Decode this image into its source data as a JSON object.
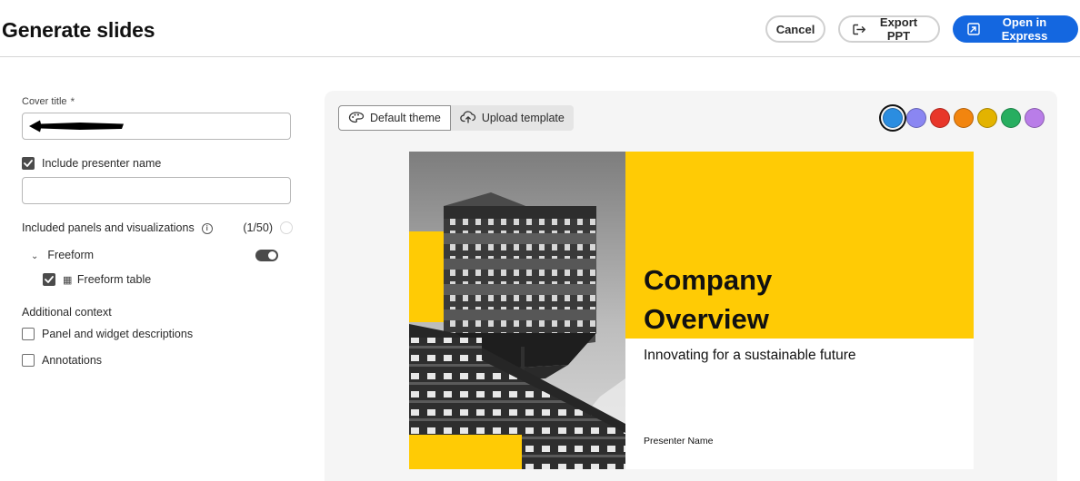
{
  "header": {
    "title": "Generate slides",
    "cancel_label": "Cancel",
    "export_label": "Export PPT",
    "open_label": "Open in Express"
  },
  "form": {
    "cover_title_label": "Cover title",
    "required_marker": "*",
    "include_presenter_label": "Include presenter name",
    "include_presenter_checked": true,
    "presenter_value": "",
    "panels_label": "Included panels and visualizations",
    "panels_count": "(1/50)",
    "freeform_label": "Freeform",
    "freeform_toggle_on": true,
    "freeform_table_label": "Freeform table",
    "freeform_table_checked": true,
    "additional_context_label": "Additional context",
    "panel_descriptions_label": "Panel and widget descriptions",
    "panel_descriptions_checked": false,
    "annotations_label": "Annotations",
    "annotations_checked": false
  },
  "preview": {
    "default_theme_label": "Default theme",
    "upload_template_label": "Upload template",
    "swatches": [
      "#2b8de0",
      "#8a86f2",
      "#e8362a",
      "#f2850f",
      "#e3b300",
      "#27ae60",
      "#b97de8"
    ],
    "selected_swatch_index": 0
  },
  "slide": {
    "title_line1": "Company",
    "title_line2": "Overview",
    "subtitle": "Innovating for a sustainable future",
    "presenter": "Presenter Name",
    "accent": "#ffcb05"
  }
}
